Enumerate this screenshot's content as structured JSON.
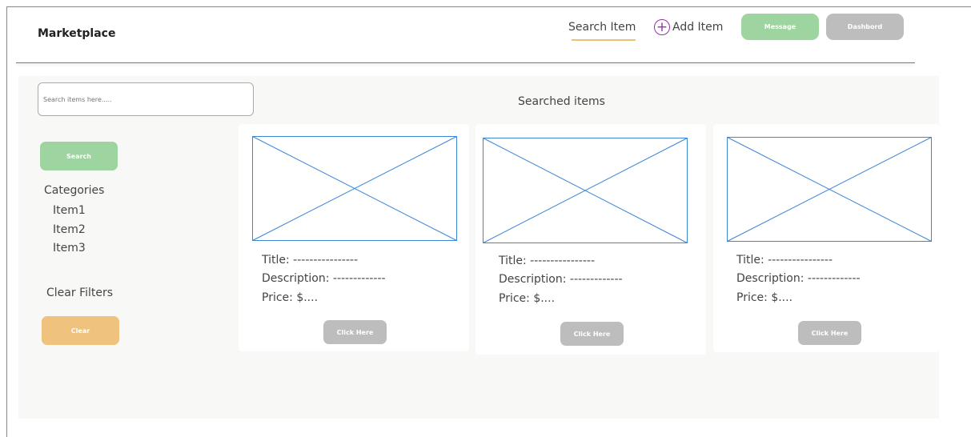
{
  "header": {
    "brand": "Marketplace",
    "nav_search": "Search Item",
    "nav_add": "Add Item",
    "message_button": "Message",
    "dashboard_button": "Dashbord"
  },
  "sidebar": {
    "search_placeholder": "Search items here.....",
    "search_button": "Search",
    "categories_title": "Categories",
    "categories": [
      "Item1",
      "Item2",
      "Item3"
    ],
    "clear_filters_title": "Clear Filters",
    "clear_button": "Clear"
  },
  "main": {
    "title": "Searched items",
    "cards": [
      {
        "title": "Title: ----------------",
        "description": "Description: -------------",
        "price": "Price: $....",
        "button": "Click Here"
      },
      {
        "title": "Title: ----------------",
        "description": "Description: -------------",
        "price": "Price: $....",
        "button": "Click Here"
      },
      {
        "title": "Title: ----------------",
        "description": "Description: -------------",
        "price": "Price: $....",
        "button": "Click Here"
      }
    ]
  },
  "colors": {
    "accent_green": "#9ed49f",
    "accent_orange": "#efc27e",
    "neutral_button": "#bdbdbd",
    "add_icon": "#9b2fae",
    "placeholder_image_stroke": "#3b86d6"
  }
}
